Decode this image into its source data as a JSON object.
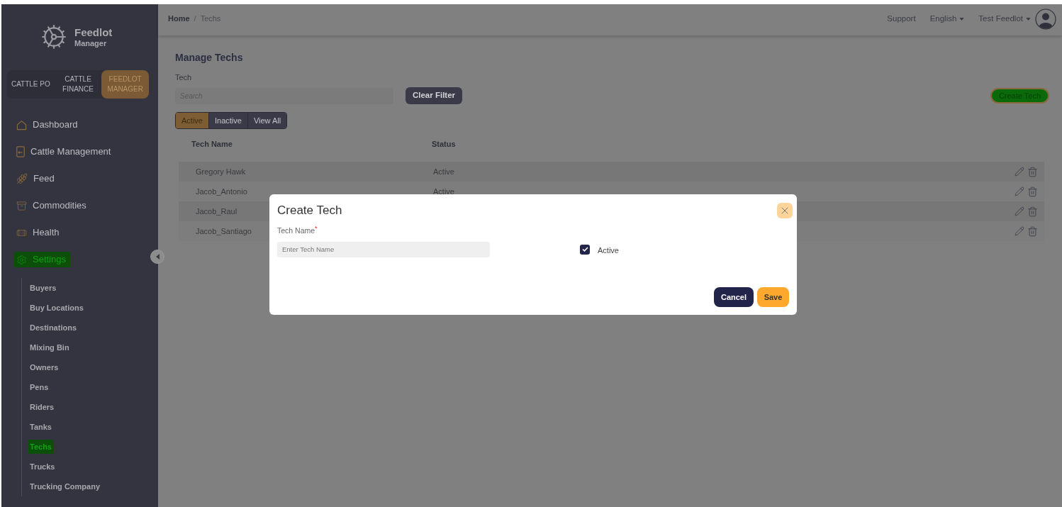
{
  "brand": {
    "title": "Feedlot",
    "subtitle": "Manager"
  },
  "product_switcher": [
    {
      "label": "CATTLE PO",
      "selected": false
    },
    {
      "label": "CATTLE FINANCE",
      "selected": false
    },
    {
      "label": "FEEDLOT MANAGER",
      "selected": true
    }
  ],
  "sidebar": {
    "items": [
      {
        "label": "Dashboard",
        "highlighted": false
      },
      {
        "label": "Cattle Management",
        "highlighted": false
      },
      {
        "label": "Feed",
        "highlighted": false
      },
      {
        "label": "Commodities",
        "highlighted": false
      },
      {
        "label": "Health",
        "highlighted": false
      },
      {
        "label": "Settings",
        "highlighted": true,
        "children": [
          {
            "label": "Buyers",
            "highlighted": false
          },
          {
            "label": "Buy Locations",
            "highlighted": false
          },
          {
            "label": "Destinations",
            "highlighted": false
          },
          {
            "label": "Mixing Bin",
            "highlighted": false
          },
          {
            "label": "Owners",
            "highlighted": false
          },
          {
            "label": "Pens",
            "highlighted": false
          },
          {
            "label": "Riders",
            "highlighted": false
          },
          {
            "label": "Tanks",
            "highlighted": false
          },
          {
            "label": "Techs",
            "highlighted": true
          },
          {
            "label": "Trucks",
            "highlighted": false
          },
          {
            "label": "Trucking Company",
            "highlighted": false
          }
        ]
      }
    ]
  },
  "header": {
    "breadcrumb": [
      {
        "label": "Home"
      },
      {
        "label": "Techs"
      }
    ],
    "breadcrumb_separator": "/",
    "support": "Support",
    "language": "English",
    "account": "Test Feedlot"
  },
  "page": {
    "title": "Manage Techs",
    "filter_label": "Tech",
    "search": {
      "placeholder": "Search"
    },
    "clear_button": "Clear Filter",
    "create_button": {
      "label": "Create Tech",
      "highlighted": true
    },
    "status_tabs": [
      {
        "label": "Active",
        "selected": true
      },
      {
        "label": "Inactive",
        "selected": false
      },
      {
        "label": "View All",
        "selected": false
      }
    ],
    "table": {
      "columns": [
        "Tech Name",
        "Status"
      ],
      "rows": [
        {
          "name": "Gregory Hawk",
          "status": "Active"
        },
        {
          "name": "Jacob_Antonio",
          "status": "Active"
        },
        {
          "name": "Jacob_Raul"
        },
        {
          "name": "Jacob_Santiago"
        }
      ]
    }
  },
  "modal": {
    "title": "Create Tech",
    "field": {
      "label": "Tech Name",
      "required_mark": "*",
      "placeholder": "Enter Tech Name"
    },
    "checkbox": {
      "label": "Active",
      "checked": true
    },
    "buttons": [
      {
        "label": "Cancel",
        "kind": "secondary"
      },
      {
        "label": "Save",
        "kind": "primary"
      }
    ]
  }
}
